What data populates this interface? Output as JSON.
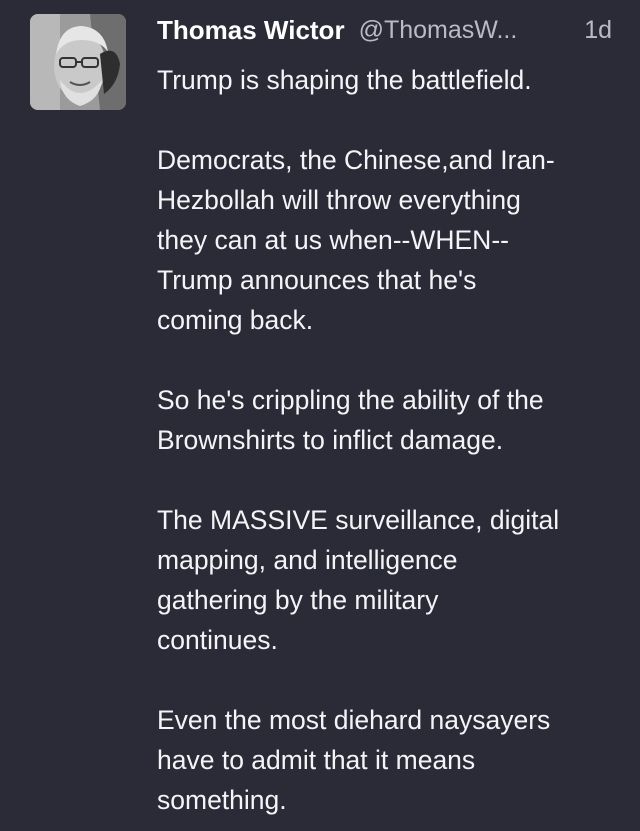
{
  "tweet": {
    "author_name": "Thomas Wictor",
    "handle": "@ThomasW...",
    "time": "1d",
    "avatar_icon": "profile-photo",
    "paragraphs": [
      {
        "lines": [
          "Trump is shaping the battlefield."
        ]
      },
      {
        "lines": [
          "Democrats, the Chinese,and Iran-",
          "Hezbollah will throw everything",
          "they can at us when--WHEN--",
          "Trump announces that he's",
          "coming back."
        ]
      },
      {
        "lines": [
          "So he's crippling the ability of the",
          "Brownshirts to inflict damage."
        ]
      },
      {
        "lines": [
          "The MASSIVE surveillance, digital",
          "mapping, and intelligence",
          "gathering by the military",
          "continues."
        ]
      },
      {
        "lines": [
          "Even the most diehard naysayers",
          "have to admit that it means",
          "something."
        ]
      }
    ]
  },
  "colors": {
    "background": "#2a2b37",
    "text": "#f4f4f6",
    "secondary_text": "#b9bac4"
  }
}
